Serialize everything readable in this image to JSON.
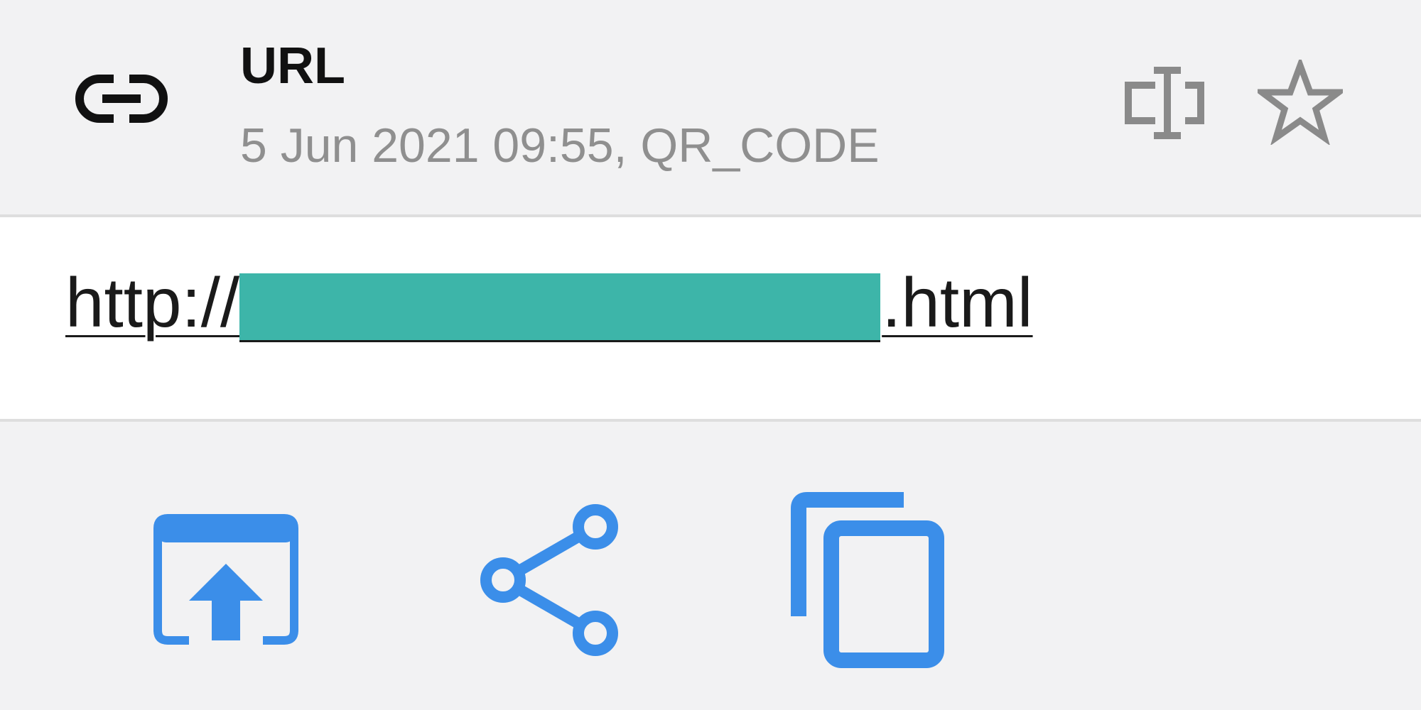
{
  "header": {
    "type_icon": "link-icon",
    "title": "URL",
    "subtitle": "5 Jun 2021 09:55, QR_CODE",
    "edit_icon": "text-format-icon",
    "favorite_icon": "star-outline-icon"
  },
  "content": {
    "url_prefix": "http://",
    "url_suffix": ".html",
    "redaction_color": "#3db5a9"
  },
  "actions": {
    "items": [
      {
        "name": "open-in-browser-icon"
      },
      {
        "name": "share-icon"
      },
      {
        "name": "copy-icon"
      }
    ],
    "accent_color": "#3b8ee9"
  },
  "colors": {
    "background": "#f2f2f3",
    "content_background": "#ffffff",
    "title": "#111111",
    "subtitle": "#8f8f8f",
    "icon_gray": "#8a8a8a"
  }
}
